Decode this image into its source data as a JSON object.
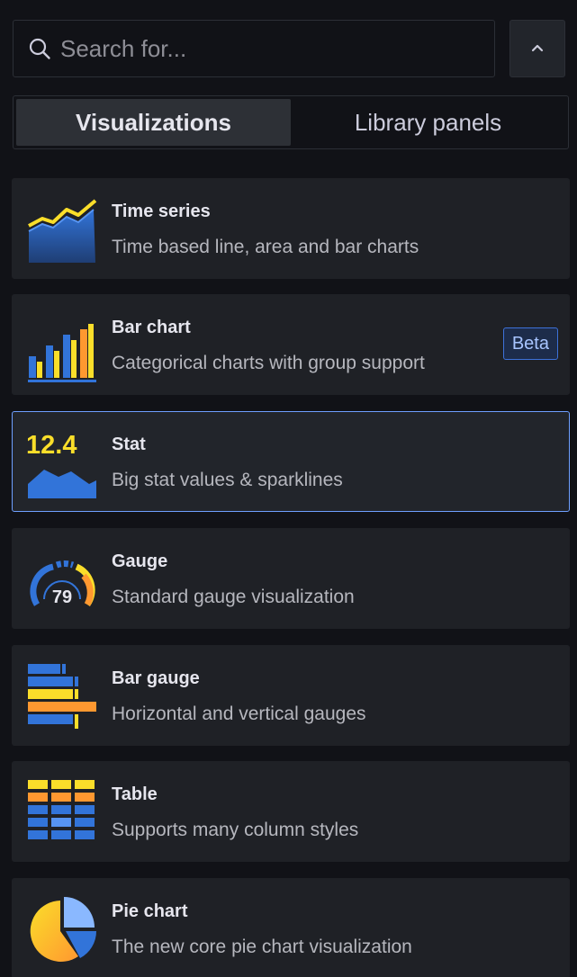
{
  "search": {
    "placeholder": "Search for...",
    "value": ""
  },
  "collapse_button": {
    "icon": "chevron-up-icon"
  },
  "tabs": [
    {
      "label": "Visualizations",
      "active": true
    },
    {
      "label": "Library panels",
      "active": false
    }
  ],
  "visualizations": [
    {
      "title": "Time series",
      "description": "Time based line, area and bar charts",
      "icon": "time-series-icon",
      "selected": false,
      "badge": ""
    },
    {
      "title": "Bar chart",
      "description": "Categorical charts with group support",
      "icon": "bar-chart-icon",
      "selected": false,
      "badge": "Beta"
    },
    {
      "title": "Stat",
      "description": "Big stat values & sparklines",
      "icon": "stat-icon",
      "icon_text": "12.4",
      "selected": true,
      "badge": ""
    },
    {
      "title": "Gauge",
      "description": "Standard gauge visualization",
      "icon": "gauge-icon",
      "icon_text": "79",
      "selected": false,
      "badge": ""
    },
    {
      "title": "Bar gauge",
      "description": "Horizontal and vertical gauges",
      "icon": "bar-gauge-icon",
      "selected": false,
      "badge": ""
    },
    {
      "title": "Table",
      "description": "Supports many column styles",
      "icon": "table-icon",
      "selected": false,
      "badge": ""
    },
    {
      "title": "Pie chart",
      "description": "The new core pie chart visualization",
      "icon": "pie-chart-icon",
      "selected": false,
      "badge": ""
    }
  ],
  "colors": {
    "background": "#111217",
    "card": "#1f2126",
    "selected_border": "#6e9fff",
    "accent_yellow": "#fade2a",
    "accent_orange": "#ff9830",
    "accent_blue": "#3274d9"
  }
}
